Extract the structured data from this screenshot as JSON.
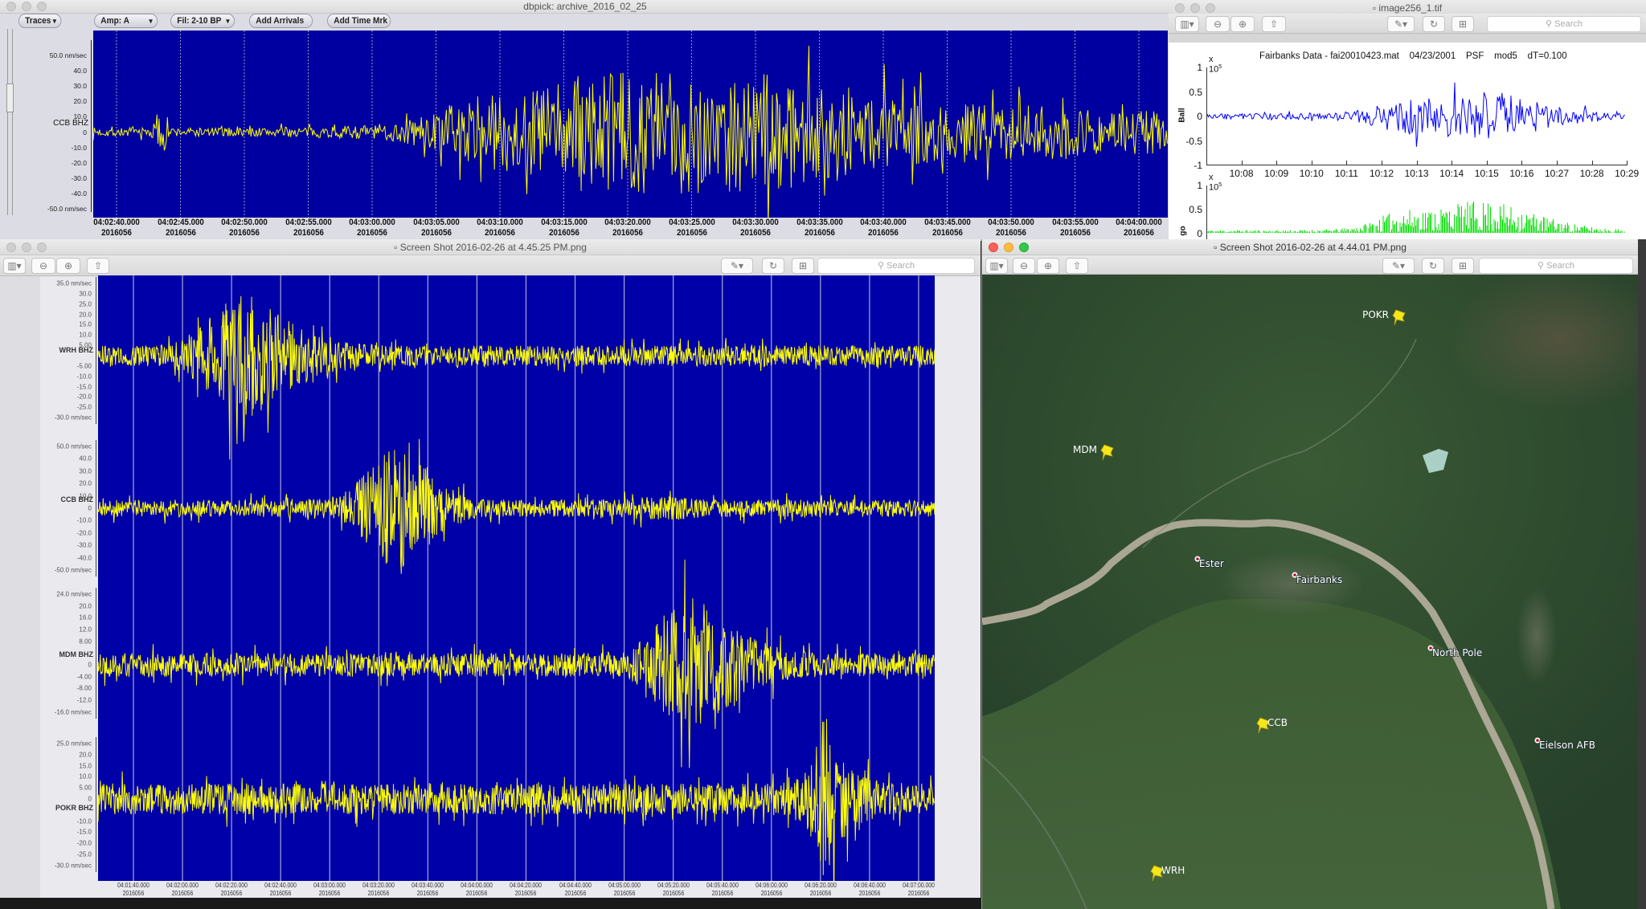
{
  "dbpick": {
    "title": "dbpick: archive_2016_02_25",
    "toolbar": {
      "traces": "Traces",
      "amp": "Amp: A",
      "filter": "Fil: 2-10 BP",
      "add_arrivals": "Add Arrivals",
      "add_time_mark": "Add Time Mrk"
    },
    "trace": {
      "station": "CCB BHZ",
      "y_ticks": [
        {
          "v": 50,
          "label": "50.0 nm/sec"
        },
        {
          "v": 40,
          "label": "40.0"
        },
        {
          "v": 30,
          "label": "30.0"
        },
        {
          "v": 20,
          "label": "20.0"
        },
        {
          "v": 10,
          "label": "10.0"
        },
        {
          "v": 0,
          "label": "0"
        },
        {
          "v": -10,
          "label": "-10.0"
        },
        {
          "v": -20,
          "label": "-20.0"
        },
        {
          "v": -30,
          "label": "-30.0"
        },
        {
          "v": -40,
          "label": "-40.0"
        },
        {
          "v": -50,
          "label": "-50.0 nm/sec"
        }
      ]
    },
    "time_ticks": [
      "04:02:40.000",
      "04:02:45.000",
      "04:02:50.000",
      "04:02:55.000",
      "04:03:00.000",
      "04:03:05.000",
      "04:03:10.000",
      "04:03:15.000",
      "04:03:20.000",
      "04:03:25.000",
      "04:03:30.000",
      "04:03:35.000",
      "04:03:40.000",
      "04:03:45.000",
      "04:03:50.000",
      "04:03:55.000",
      "04:04:00.000"
    ],
    "date": "2016056",
    "trace_color": "#ffff00",
    "plot_bg": "#0000a0"
  },
  "matlab": {
    "title": "image256_1.tif",
    "search_placeholder": "Search",
    "plot_title": "Fairbanks Data - fai20010423.mat    04/23/2001    PSF    mod5    dT=0.100",
    "exponent_base": "x 10",
    "exponent_power": "5",
    "ylabel": "Ball",
    "y_ticks": [
      "1",
      "0.5",
      "0",
      "-0.5",
      "-1"
    ],
    "x_ticks": [
      "10:08",
      "10:09",
      "10:10",
      "10:11",
      "10:12",
      "10:13",
      "10:14",
      "10:15",
      "10:16",
      "10:27",
      "10:28",
      "10:29"
    ],
    "second_ylabel": "go",
    "second_y_ticks": [
      "1",
      "0.5",
      "0"
    ],
    "line_color": "#0000ff",
    "second_line_color": "#00dd00"
  },
  "preview_traces": {
    "title": "Screen Shot 2016-02-26 at 4.45.25 PM.png",
    "search_placeholder": "Search",
    "traces": [
      {
        "station": "WRH BHZ",
        "y_ticks": [
          {
            "v": 35,
            "label": "35.0 nm/sec"
          },
          {
            "v": 30,
            "label": "30.0"
          },
          {
            "v": 25,
            "label": "25.0"
          },
          {
            "v": 20,
            "label": "20.0"
          },
          {
            "v": 15,
            "label": "15.0"
          },
          {
            "v": 10,
            "label": "10.0"
          },
          {
            "v": 5,
            "label": "5.00"
          },
          {
            "v": -5,
            "label": "-5.00"
          },
          {
            "v": -10,
            "label": "-10.0"
          },
          {
            "v": -15,
            "label": "-15.0"
          },
          {
            "v": -20,
            "label": "-20.0"
          },
          {
            "v": -25,
            "label": "-25.0"
          },
          {
            "v": -30,
            "label": "-30.0 nm/sec"
          }
        ]
      },
      {
        "station": "CCB BHZ",
        "y_ticks": [
          {
            "v": 50,
            "label": "50.0 nm/sec"
          },
          {
            "v": 40,
            "label": "40.0"
          },
          {
            "v": 30,
            "label": "30.0"
          },
          {
            "v": 20,
            "label": "20.0"
          },
          {
            "v": 10,
            "label": "10.0"
          },
          {
            "v": 0,
            "label": "0"
          },
          {
            "v": -10,
            "label": "-10.0"
          },
          {
            "v": -20,
            "label": "-20.0"
          },
          {
            "v": -30,
            "label": "-30.0"
          },
          {
            "v": -40,
            "label": "-40.0"
          },
          {
            "v": -50,
            "label": "-50.0 nm/sec"
          }
        ]
      },
      {
        "station": "MDM BHZ",
        "y_ticks": [
          {
            "v": 24,
            "label": "24.0 nm/sec"
          },
          {
            "v": 20,
            "label": "20.0"
          },
          {
            "v": 16,
            "label": "16.0"
          },
          {
            "v": 12,
            "label": "12.0"
          },
          {
            "v": 8,
            "label": "8.00"
          },
          {
            "v": 0,
            "label": "0"
          },
          {
            "v": -4,
            "label": "-4.00"
          },
          {
            "v": -8,
            "label": "-8.00"
          },
          {
            "v": -12,
            "label": "-12.0"
          },
          {
            "v": -16,
            "label": "-16.0 nm/sec"
          }
        ]
      },
      {
        "station": "POKR BHZ",
        "y_ticks": [
          {
            "v": 25,
            "label": "25.0 nm/sec"
          },
          {
            "v": 20,
            "label": "20.0"
          },
          {
            "v": 15,
            "label": "15.0"
          },
          {
            "v": 10,
            "label": "10.0"
          },
          {
            "v": 5,
            "label": "5.00"
          },
          {
            "v": 0,
            "label": "0"
          },
          {
            "v": -10,
            "label": "-10.0"
          },
          {
            "v": -15,
            "label": "-15.0"
          },
          {
            "v": -20,
            "label": "-20.0"
          },
          {
            "v": -25,
            "label": "-25.0"
          },
          {
            "v": -30,
            "label": "-30.0 nm/sec"
          }
        ]
      }
    ],
    "time_ticks": [
      "04:01:40.000",
      "04:02:00.000",
      "04:02:20.000",
      "04:02:40.000",
      "04:03:00.000",
      "04:03:20.000",
      "04:03:40.000",
      "04:04:00.000",
      "04:04:20.000",
      "04:04:40.000",
      "04:05:00.000",
      "04:05:20.000",
      "04:05:40.000",
      "04:06:00.000",
      "04:06:20.000",
      "04:06:40.000",
      "04:07:00.000"
    ],
    "date": "2016056"
  },
  "map": {
    "title": "Screen Shot 2016-02-26 at 4.44.01 PM.png",
    "search_placeholder": "Search",
    "stations": [
      {
        "name": "POKR"
      },
      {
        "name": "MDM"
      },
      {
        "name": "CCB"
      },
      {
        "name": "WRH"
      }
    ],
    "places": [
      {
        "name": "Ester"
      },
      {
        "name": "Fairbanks"
      },
      {
        "name": "North Pole"
      },
      {
        "name": "Eielson AFB"
      }
    ],
    "pin_color": "#f5e61a"
  }
}
